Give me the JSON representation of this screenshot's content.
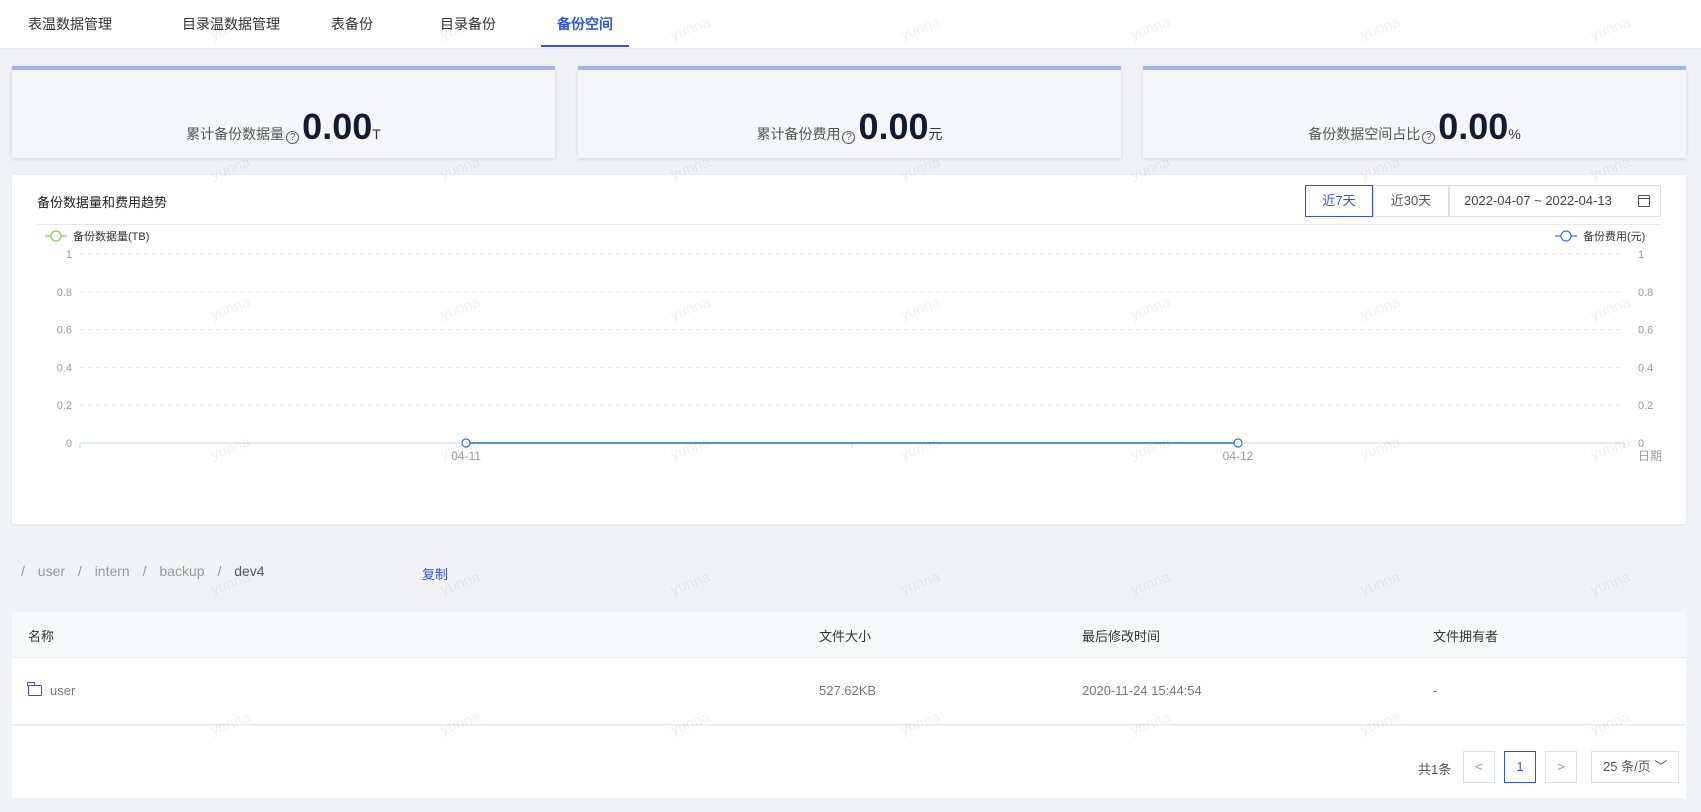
{
  "tabs": [
    {
      "label": "表温数据管理",
      "active": false
    },
    {
      "label": "目录温数据管理",
      "active": false
    },
    {
      "label": "表备份",
      "active": false
    },
    {
      "label": "目录备份",
      "active": false
    },
    {
      "label": "备份空间",
      "active": true
    }
  ],
  "stats": [
    {
      "label": "累计备份数据量",
      "value": "0.00",
      "unit": "T"
    },
    {
      "label": "累计备份费用",
      "value": "0.00",
      "unit": "元"
    },
    {
      "label": "备份数据空间占比",
      "value": "0.00",
      "unit": "%"
    }
  ],
  "chart_panel": {
    "title": "备份数据量和费用趋势",
    "range_7": "近7天",
    "range_30": "近30天",
    "date_range": "2022-04-07 ~ 2022-04-13"
  },
  "chart_data": {
    "type": "line",
    "x": [
      "04-11",
      "04-12"
    ],
    "xlabel": "日期",
    "series": [
      {
        "name": "备份数据量(TB)",
        "values": [
          0,
          0
        ],
        "axis": "left",
        "color": "#7ecf51"
      },
      {
        "name": "备份费用(元)",
        "values": [
          0,
          0
        ],
        "axis": "right",
        "color": "#2f7de1"
      }
    ],
    "y_ticks": [
      "0",
      "0.2",
      "0.4",
      "0.6",
      "0.8",
      "1"
    ],
    "ylim": [
      0,
      1
    ],
    "grid": true,
    "legend": "top"
  },
  "breadcrumb": [
    "/",
    "user",
    "/",
    "intern",
    "/",
    "backup",
    "/",
    "dev4"
  ],
  "copy_label": "复制",
  "table": {
    "headers": [
      "名称",
      "文件大小",
      "最后修改时间",
      "文件拥有者"
    ],
    "rows": [
      {
        "name": "user",
        "size": "527.62KB",
        "modified": "2020-11-24 15:44:54",
        "owner": "-"
      }
    ]
  },
  "pagination": {
    "total": "共1条",
    "prev": "<",
    "page": "1",
    "next": ">",
    "page_size": "25 条/页"
  },
  "watermark": "yunna",
  "colors": {
    "accent": "#2f54eb",
    "card_top": "#9db4f5"
  }
}
